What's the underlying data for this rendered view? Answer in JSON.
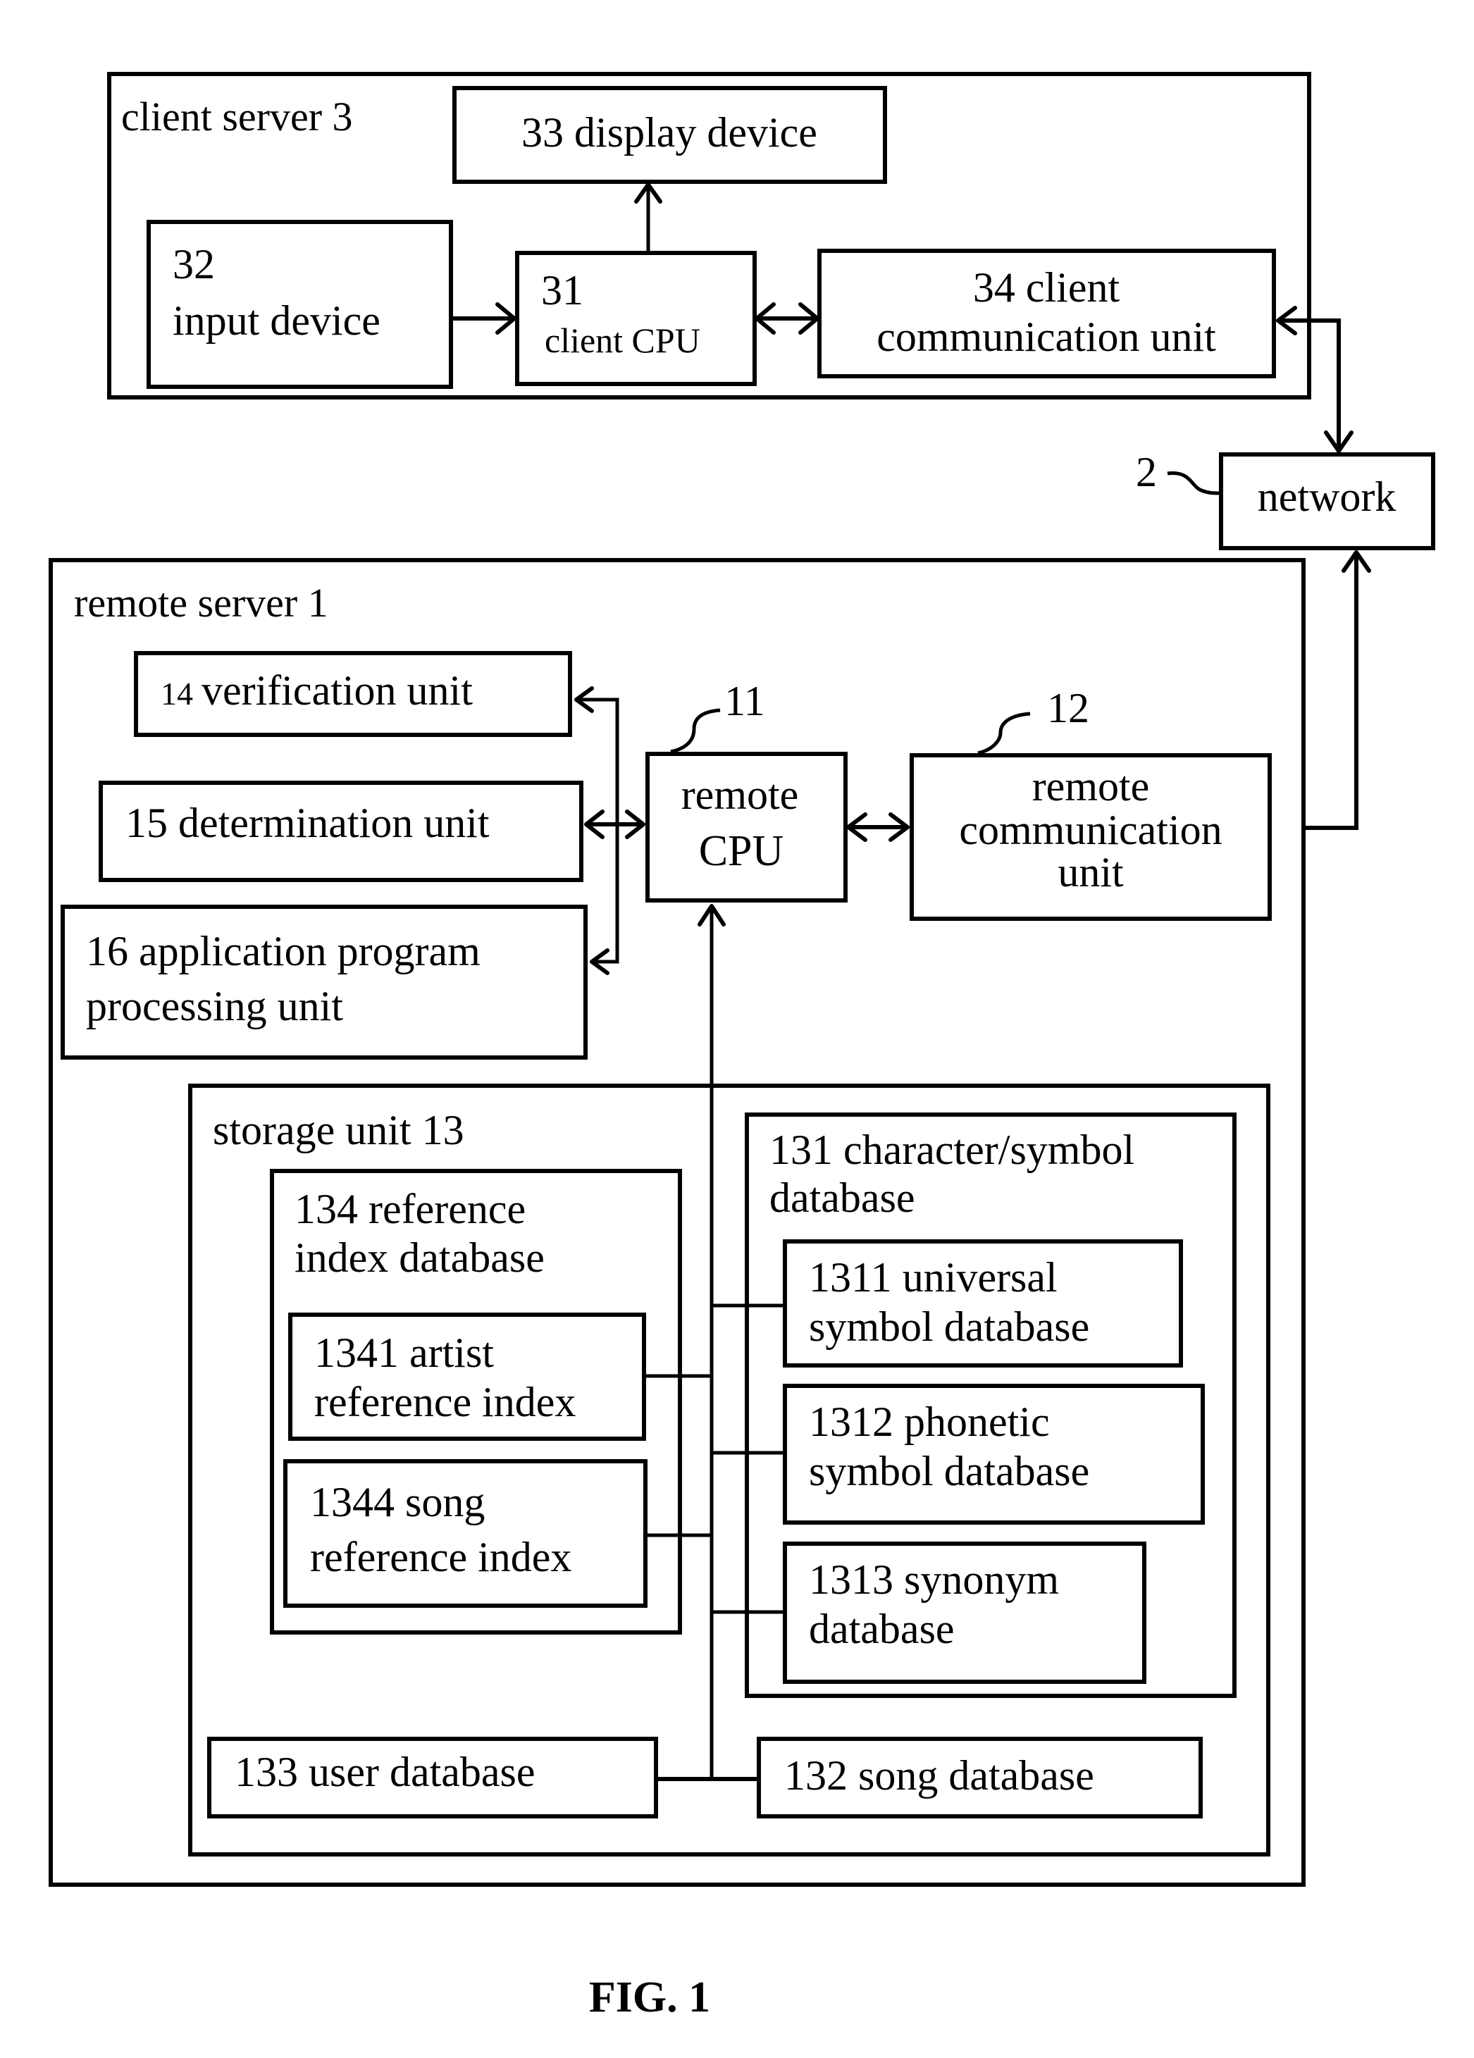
{
  "figure": {
    "caption": "FIG. 1",
    "client_server": {
      "title": "client server 3",
      "display_device": "33 display device",
      "input_device": {
        "line1": "32",
        "line2": "input device"
      },
      "client_cpu": {
        "line1": "31",
        "line2": "client CPU"
      },
      "client_comm": {
        "line1": "34 client",
        "line2": "communication unit"
      }
    },
    "network": {
      "label": "network",
      "ref": "2"
    },
    "remote_server": {
      "title": "remote server 1",
      "verification_unit": {
        "num": "14",
        "text": "verification unit"
      },
      "determination_unit": "15 determination unit",
      "app_processing_unit": {
        "line1": "16 application program",
        "line2": "processing unit"
      },
      "remote_cpu": {
        "line1": "remote",
        "line2": "CPU",
        "ref": "11"
      },
      "remote_comm": {
        "line1": "remote",
        "line2": "communication",
        "line3": "unit",
        "ref": "12"
      },
      "storage_unit": {
        "title": "storage unit 13",
        "reference_index_db": {
          "line1": "134 reference",
          "line2": "index database"
        },
        "artist_ref_index": {
          "line1": "1341 artist",
          "line2": "reference index"
        },
        "song_ref_index": {
          "line1": "1344 song",
          "line2": "reference index"
        },
        "char_symbol_db": {
          "line1": "131 character/symbol",
          "line2": "database"
        },
        "universal_symbol_db": {
          "line1": "1311 universal",
          "line2": "symbol database"
        },
        "phonetic_symbol_db": {
          "line1": "1312 phonetic",
          "line2": "symbol database"
        },
        "synonym_db": {
          "line1": "1313 synonym",
          "line2": "database"
        },
        "user_db": "133 user database",
        "song_db": "132 song database"
      }
    }
  }
}
